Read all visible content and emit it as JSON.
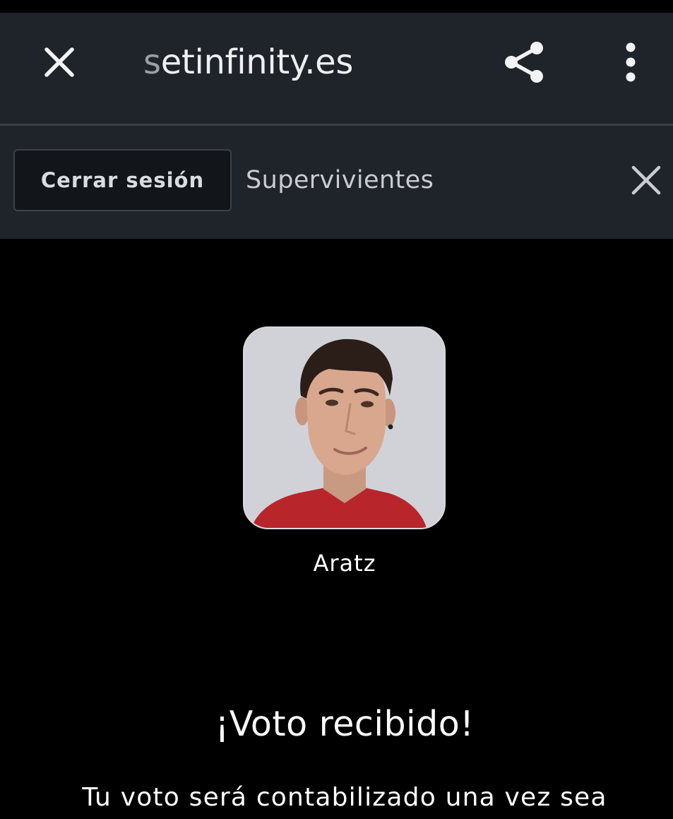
{
  "browser": {
    "url_prefix": "s",
    "url_rest": "etinfinity.es",
    "close_icon": "close-icon",
    "share_icon": "share-icon",
    "menu_icon": "more-vert-icon"
  },
  "site_header": {
    "logout_label": "Cerrar sesión",
    "title": "Supervivientes",
    "close_icon": "close-icon"
  },
  "vote": {
    "candidate_name": "Aratz",
    "confirmation_title": "¡Voto recibido!",
    "confirmation_text": "Tu voto será contabilizado una vez sea"
  },
  "colors": {
    "browser_bar": "#1f232a",
    "background": "#000000",
    "text": "#ffffff",
    "logout_button": "#121519"
  }
}
